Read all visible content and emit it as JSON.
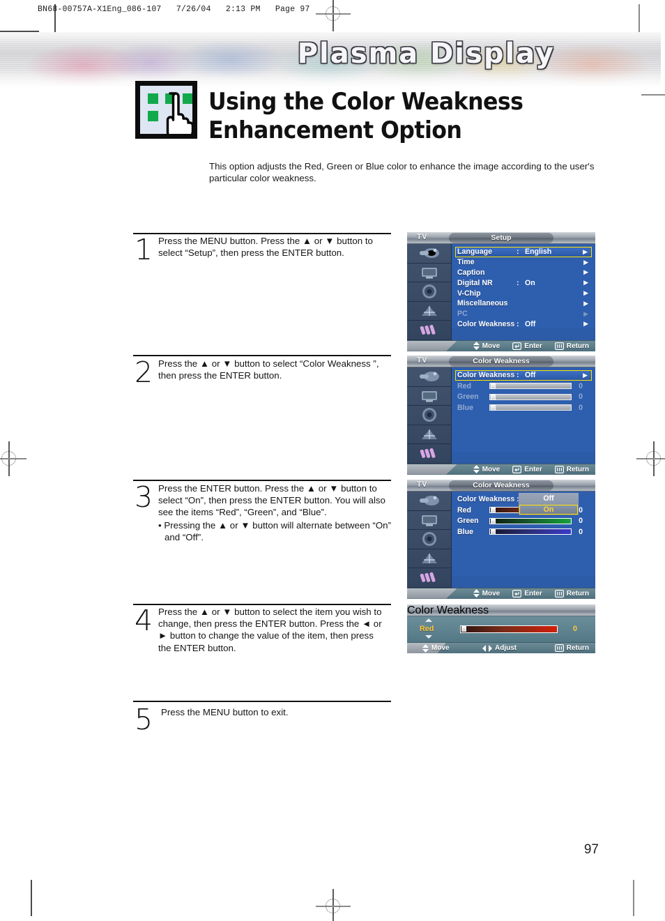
{
  "print": {
    "slug": "BN68-00757A-X1Eng_086-107   7/26/04   2:13 PM   Page 97",
    "page_number": "97"
  },
  "banner": {
    "text": "Plasma Display"
  },
  "heading": {
    "title": "Using the Color Weakness Enhancement Option",
    "subtitle": "This option adjusts the Red, Green or Blue color to enhance the image according to the user's particular color weakness.",
    "icon": "hand-pointing-menu-icon"
  },
  "steps": [
    {
      "number": "1",
      "text": "Press the MENU button. Press the ▲ or ▼ button to select “Setup”, then press the ENTER button."
    },
    {
      "number": "2",
      "text": "Press the ▲ or ▼ button to select “Color Weakness ”, then press the ENTER button."
    },
    {
      "number": "3",
      "text": "Press the ENTER button. Press the ▲ or ▼ button to select “On”, then press the ENTER button. You will also see the items “Red”, “Green”, and “Blue”.",
      "bullet": "• Pressing the ▲ or ▼ button will alternate between “On” and “Off”."
    },
    {
      "number": "4",
      "text": "Press the ▲ or ▼ button to select the item you wish to change, then press the ENTER button. Press the ◄ or ► button to change the value of the item, then press the ENTER button."
    },
    {
      "number": "5",
      "text": "Press the MENU button to exit."
    }
  ],
  "osd": {
    "source_label": "TV",
    "footer_default": [
      {
        "icon": "up-down-arrows-icon",
        "label": "Move"
      },
      {
        "icon": "enter-key-icon",
        "label": "Enter"
      },
      {
        "icon": "menu-key-icon",
        "label": "Return"
      }
    ],
    "footer_adjust": [
      {
        "icon": "up-down-arrows-icon",
        "label": "Move"
      },
      {
        "icon": "left-right-arrows-icon",
        "label": "Adjust"
      },
      {
        "icon": "menu-key-icon",
        "label": "Return"
      }
    ],
    "sidebar_icons": [
      "input-source-icon",
      "picture-screen-icon",
      "sound-speaker-icon",
      "channel-antenna-icon",
      "setup-tools-icon"
    ],
    "panel1": {
      "title": "Setup",
      "items": [
        {
          "label": "Language",
          "colon": ":",
          "value": "English",
          "selected": true,
          "dimmed": false,
          "arrow": "▶"
        },
        {
          "label": "Time",
          "colon": "",
          "value": "",
          "selected": false,
          "dimmed": false,
          "arrow": "▶"
        },
        {
          "label": "Caption",
          "colon": "",
          "value": "",
          "selected": false,
          "dimmed": false,
          "arrow": "▶"
        },
        {
          "label": "Digital NR",
          "colon": ":",
          "value": "On",
          "selected": false,
          "dimmed": false,
          "arrow": "▶"
        },
        {
          "label": "V-Chip",
          "colon": "",
          "value": "",
          "selected": false,
          "dimmed": false,
          "arrow": "▶"
        },
        {
          "label": "Miscellaneous",
          "colon": "",
          "value": "",
          "selected": false,
          "dimmed": false,
          "arrow": "▶"
        },
        {
          "label": "PC",
          "colon": "",
          "value": "",
          "selected": false,
          "dimmed": true,
          "arrow": "▶"
        },
        {
          "label": "Color Weakness",
          "colon": ":",
          "value": "Off",
          "selected": false,
          "dimmed": false,
          "arrow": "▶"
        }
      ]
    },
    "panel2": {
      "title": "Color Weakness",
      "toggle": {
        "label": "Color Weakness",
        "colon": ":",
        "value": "Off",
        "arrow": "▶"
      },
      "sliders": [
        {
          "label": "Red",
          "value": "0",
          "enabled": false
        },
        {
          "label": "Green",
          "value": "0",
          "enabled": false
        },
        {
          "label": "Blue",
          "value": "0",
          "enabled": false
        }
      ]
    },
    "panel3": {
      "title": "Color Weakness",
      "toggle": {
        "label": "Color Weakness",
        "colon": ":"
      },
      "dropdown": {
        "options": [
          "Off",
          "On"
        ],
        "highlighted": "On"
      },
      "sliders": [
        {
          "label": "Red",
          "value": "0",
          "enabled": true
        },
        {
          "label": "Green",
          "value": "0",
          "enabled": true
        },
        {
          "label": "Blue",
          "value": "0",
          "enabled": true
        }
      ]
    },
    "panel4": {
      "title": "Color Weakness",
      "item_label": "Red",
      "value": "0"
    }
  }
}
